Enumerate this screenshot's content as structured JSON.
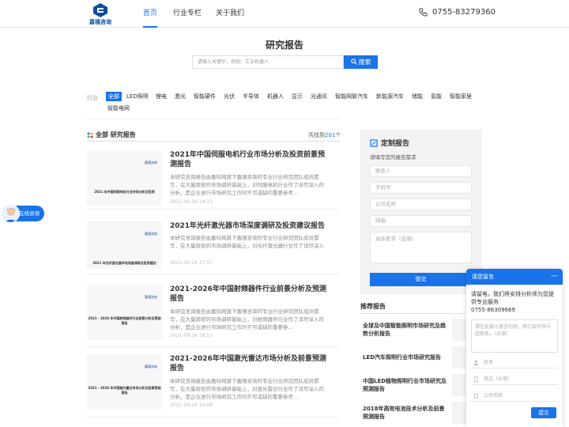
{
  "header": {
    "logo_text": "嘉禧咨询",
    "nav": [
      {
        "label": "首页",
        "active": true
      },
      {
        "label": "行业专栏",
        "active": false
      },
      {
        "label": "关于我们",
        "active": false
      }
    ],
    "phone": "0755-83279360"
  },
  "page": {
    "title": "研究报告",
    "search_placeholder": "请输入关键字，例如：工业机器人",
    "search_button": "搜索"
  },
  "filter": {
    "label": "行业",
    "items": [
      "全部",
      "LED照明",
      "锂电",
      "激光",
      "智能硬件",
      "光伏",
      "半导体",
      "机器人",
      "显示",
      "光通讯",
      "智能网联汽车",
      "新能源汽车",
      "储能",
      "氢能",
      "智能家居",
      "智能电网"
    ],
    "active_index": 0
  },
  "list": {
    "section_title": "全部 研究报告",
    "count_prefix": "共找到",
    "count": "201",
    "count_suffix": "个",
    "thumb_logo": "嘉禧咨询",
    "cards": [
      {
        "title": "2021年中国伺服电机行业市场分析及投资前景预测报告",
        "thumb_title": "2021 年中国伺服电机行业市场分析及投资",
        "desc": "本研究咨询报告由嘉科网旗下嘉禧咨询的专业行业研究团队成员撰写，在大量周密的市场调研基础上，对伺服电机行业作了详尽深入的分析，是企业进行市场研究工作时不可或缺的重要参考...",
        "date": "2021-09-26 18:31"
      },
      {
        "title": "2021年光纤激光器市场深度调研及投资建议报告",
        "thumb_title": "2021 年光纤激光器市场深度调研及投资建议",
        "desc": "本研究咨询报告由嘉科网旗下嘉禧咨询的专业行业研究团队成员撰写，在大量周密的市场调研基础上，对光纤激光器行业作了详尽深入的分析，是企业进行市场研究工作时不可或缺的重要参...",
        "date": "2021-09-26 17:57"
      },
      {
        "title": "2021-2026年中国射频器件行业前景分析及预测报告",
        "thumb_title": "2021 - 2026 年中国射频器件行业前景分析及预测报告",
        "desc": "本研究咨询报告由嘉科网旗下嘉禧咨询的专业行业研究团队成员撰写，在大量周密的市场调研基础上，对射频器件行业作了详尽深入的分析，是企业进行市场研究工作时不可或缺的重要参...",
        "date": "2021-09-26 18:51"
      },
      {
        "title": "2021-2026年中国激光雷达市场分析及前景预测报告",
        "thumb_title": "2021 - 2026 年中国激光雷达市场分析及前景预测报告",
        "desc": "本研究咨询报告由嘉科网旗下嘉禧咨询的专业行业研究团队成员撰写，在大量周密的市场调研基础上，对激光雷达行业作了详尽深入的分析，是企业进行市场研究工作时不可或缺的重要参考...",
        "date": "2021-09-26 16:09"
      }
    ]
  },
  "custom": {
    "title": "定制报告",
    "subtitle": "请填写您的报告需求",
    "fields": [
      "联系人",
      "手机号",
      "公司名称",
      "邮箱"
    ],
    "textarea": "具体要求（选填）",
    "submit": "提交"
  },
  "recommend": {
    "title": "推荐报告",
    "items": [
      "全球及中国智能照明市场研究及趋势分析报告",
      "LED汽车照明行业市场研究报告",
      "中国LED植物照明行业市场研究及预测报告",
      "2018年高效电池技术分析及前景预测报告"
    ]
  },
  "chat": {
    "float_label": "在线咨询"
  },
  "message": {
    "title": "请您留言",
    "intro": "请留电，我们将安排分析师为您提供专业服务",
    "phone": "0755-86309669",
    "textarea": "请在此输入留言内容，我们会尽快与您联系。（必填）",
    "fields": [
      "姓名",
      "电话（必填）",
      "公司名称"
    ],
    "submit": "提交"
  },
  "colors": {
    "accent": "#1a73e8",
    "logo": "#0b4fa0"
  }
}
